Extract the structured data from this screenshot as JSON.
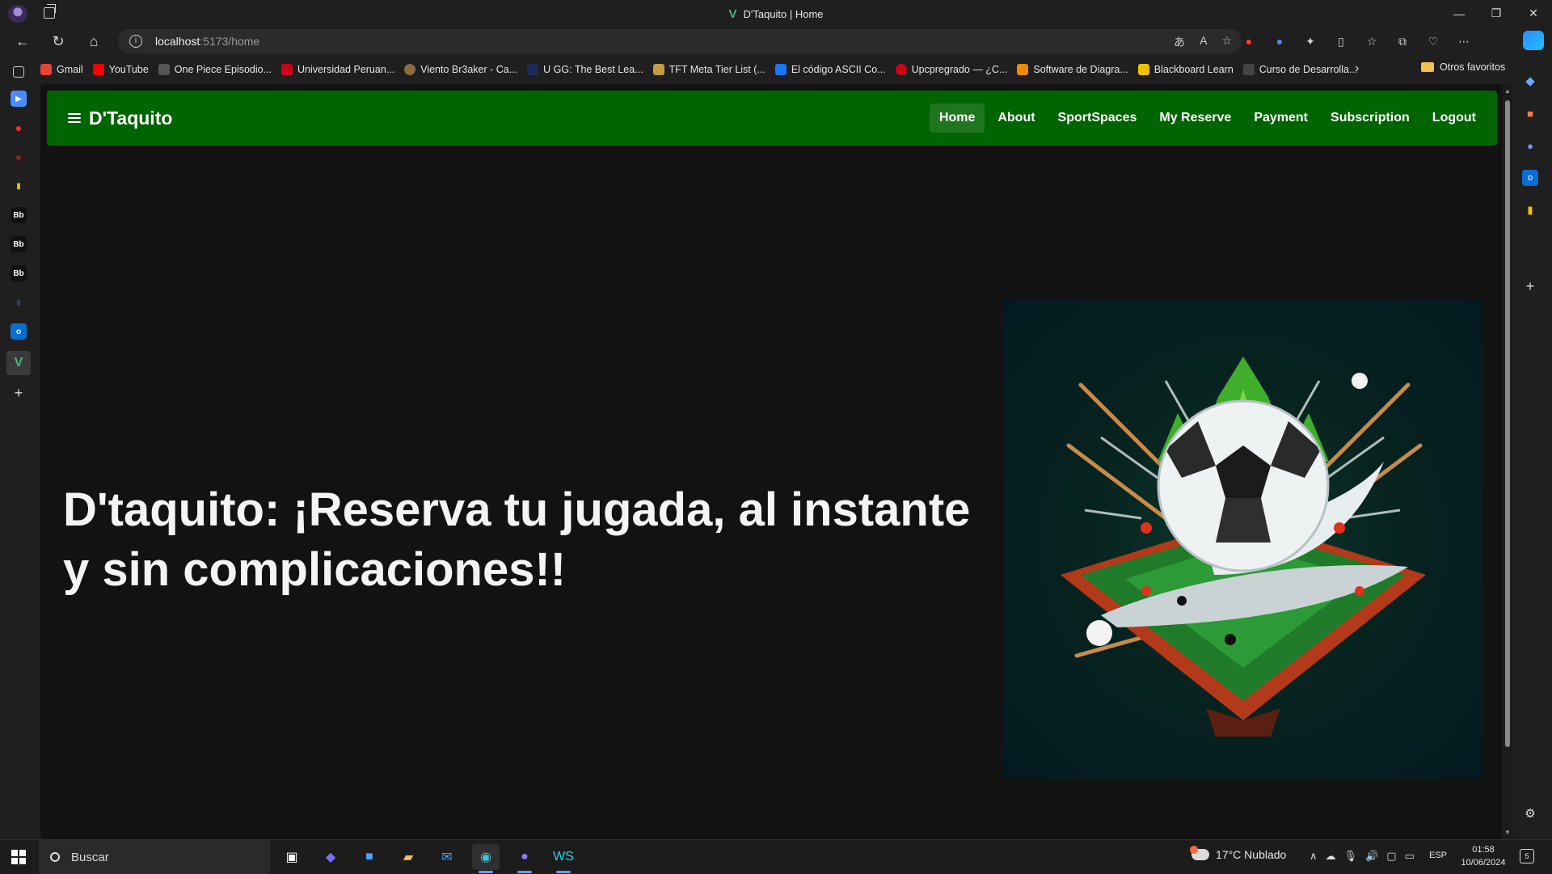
{
  "window": {
    "title": "D'Taquito | Home",
    "controls": [
      "—",
      "❐",
      "✕"
    ]
  },
  "browser": {
    "url_host": "localhost",
    "url_path": ":5173/home",
    "bookmarks": [
      {
        "label": "Gmail",
        "color": "#ea4335"
      },
      {
        "label": "YouTube",
        "color": "#ff0000"
      },
      {
        "label": "One Piece Episodio...",
        "color": "#555555"
      },
      {
        "label": "Universidad Peruan...",
        "color": "#d0021b"
      },
      {
        "label": "Viento Br3aker - Ca...",
        "color": "#8a6d3b"
      },
      {
        "label": "U GG: The Best Lea...",
        "color": "#1e2a5a"
      },
      {
        "label": "TFT Meta Tier List (...",
        "color": "#c49a45"
      },
      {
        "label": "El código ASCII Co...",
        "color": "#1677ff"
      },
      {
        "label": "Upcpregrado — ¿C...",
        "color": "#d0021b"
      },
      {
        "label": "Software de Diagra...",
        "color": "#f08a00"
      },
      {
        "label": "Blackboard Learn",
        "color": "#f2c200"
      },
      {
        "label": "Curso de Desarrolla...",
        "color": "#333333"
      }
    ],
    "other_favorites": "Otros favoritos"
  },
  "app": {
    "brand": "D'Taquito",
    "nav": [
      "Home",
      "About",
      "SportSpaces",
      "My Reserve",
      "Payment",
      "Subscription",
      "Logout"
    ],
    "active_nav": "Home",
    "hero_text": "D'taquito: ¡Reserva tu jugada, al instante y sin complicaciones!!",
    "accent_color": "#006400"
  },
  "taskbar": {
    "search_placeholder": "Buscar",
    "weather": "17°C  Nublado",
    "language": "ESP",
    "time": "01:58",
    "date": "10/06/2024",
    "notifications": "5"
  }
}
